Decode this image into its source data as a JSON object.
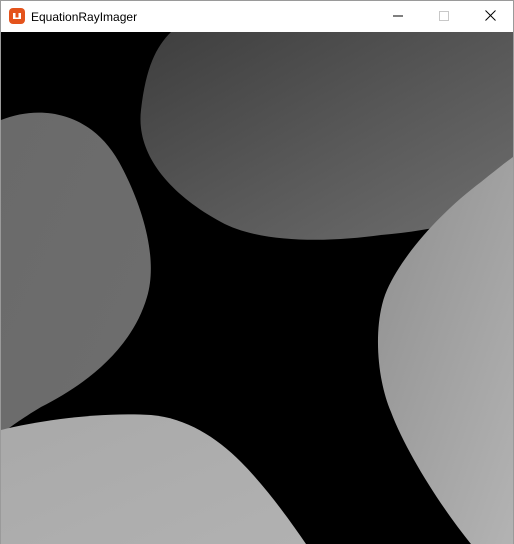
{
  "window": {
    "title": "EquationRayImager",
    "controls": {
      "minimize": "minimize",
      "maximize": "maximize",
      "close": "close"
    }
  },
  "render": {
    "background": "#000000",
    "shapes": [
      {
        "name": "top-blob",
        "color_light": "#7a7a7a",
        "color_dark": "#4a4a4a"
      },
      {
        "name": "left-blob",
        "color_light": "#8a8a8a",
        "color_dark": "#5a5a5a"
      },
      {
        "name": "right-blob",
        "color_light": "#b8b8b8",
        "color_dark": "#8f8f8f"
      },
      {
        "name": "bottom-blob",
        "color_light": "#b5b5b5",
        "color_dark": "#8c8c8c"
      }
    ]
  }
}
